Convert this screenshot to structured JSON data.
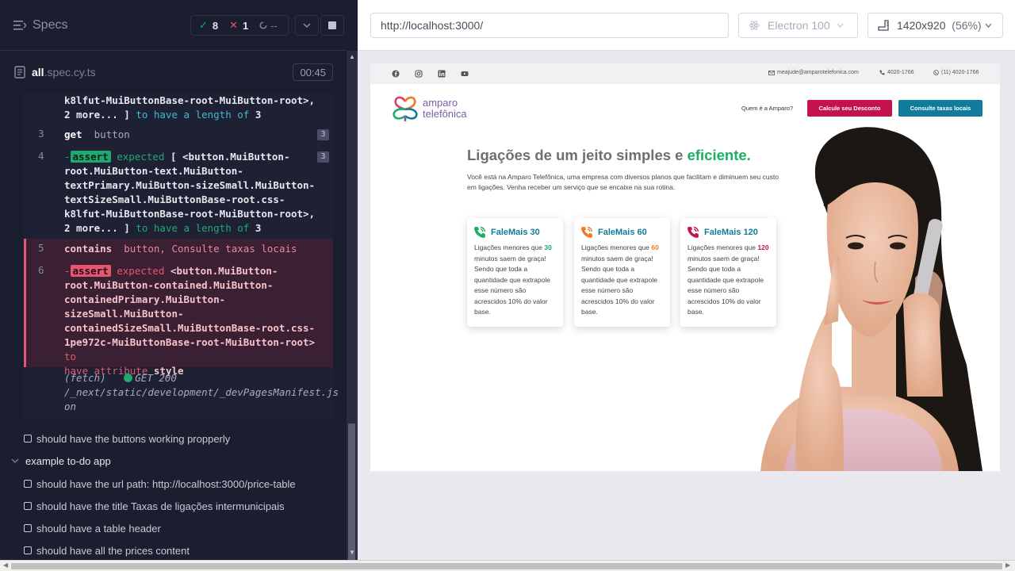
{
  "runner": {
    "title": "Specs",
    "stats": {
      "passed": "8",
      "failed": "1",
      "pending": "--"
    },
    "file": {
      "name_bold": "all",
      "name_ext": ".spec.cy.ts",
      "time": "00:45"
    }
  },
  "commands": {
    "top_line1": "k8lfut-MuiButtonBase-root-MuiButton-root>,",
    "top_line2a": "2 more... ]",
    "top_line2b": "to have a length of",
    "top_line2c": "3",
    "c3": {
      "num": "3",
      "name": "get",
      "arg": "button",
      "count": "3"
    },
    "c4": {
      "num": "4",
      "badge": "assert",
      "text1": "expected",
      "lines": [
        "[ <button.MuiButton-",
        "root.MuiButton-text.MuiButton-",
        "textPrimary.MuiButton-sizeSmall.MuiButton-",
        "textSizeSmall.MuiButtonBase-root.css-",
        "k8lfut-MuiButtonBase-root-MuiButton-root>,"
      ],
      "last_a": "2 more... ]",
      "last_b": "to have a length of",
      "last_c": "3",
      "count": "3"
    },
    "c5": {
      "num": "5",
      "name": "contains",
      "arg": "button, Consulte taxas locais"
    },
    "c6": {
      "num": "6",
      "badge": "assert",
      "text1": "expected",
      "lines": [
        "<button.MuiButton-",
        "root.MuiButton-contained.MuiButton-",
        "containedPrimary.MuiButton-",
        "sizeSmall.MuiButton-",
        "containedSizeSmall.MuiButtonBase-root.css-"
      ],
      "last_a": "1pe972c-MuiButtonBase-root-MuiButton-root>",
      "last_b": "to",
      "last_c": "have attribute",
      "last_d": "style"
    },
    "fetch": {
      "label": "(fetch)",
      "status": "GET 200",
      "path": "/_next/static/development/_devPagesManifest.js",
      "path2": "on"
    }
  },
  "tests": {
    "t1": "should have the buttons working propperly",
    "suite": "example to-do app",
    "t2": "should have the url path: http://localhost:3000/price-table",
    "t3": "should have the title Taxas de ligações intermunicipais",
    "t4": "should have a table header",
    "t5": "should have all the prices content"
  },
  "aut": {
    "url": "http://localhost:3000/",
    "browser": "Electron 100",
    "viewport": "1420x920",
    "zoom": "(56%)"
  },
  "site": {
    "email": "meajude@amparotelefonica.com",
    "phone": "4020-1766",
    "whatsapp": "(11) 4020-1766",
    "logo_line1": "amparo",
    "logo_line2": "telefônica",
    "nav_about": "Quem é a Amparo?",
    "btn_discount": "Calcule seu Desconto",
    "btn_rates": "Consulte taxas locais",
    "hero_title_a": "Ligações de um jeito simples e",
    "hero_title_b": "eficiente.",
    "hero_sub": "Você está na Amparo Telefônica, uma empresa com diversos planos que facilitam e diminuem seu custo em ligações. Venha receber um serviço que se encaixe na sua rotina.",
    "cards": [
      {
        "title": "FaleMais 30",
        "pre": "Ligações menores que",
        "num": "30",
        "post": "minutos saem de graça! Sendo que toda a quantidade que extrapole esse número são acrescidos 10% do valor base.",
        "color": "#1aaf63"
      },
      {
        "title": "FaleMais 60",
        "pre": "Ligações menores que",
        "num": "60",
        "post": "minutos saem de graça! Sendo que toda a quantidade que extrapole esse número são acrescidos 10% do valor base.",
        "color": "#f07a22"
      },
      {
        "title": "FaleMais 120",
        "pre": "Ligações menores que",
        "num": "120",
        "post": "minutos saem de graça! Sendo que toda a quantidade que extrapole esse número são acrescidos 10% do valor base.",
        "color": "#c4124c"
      }
    ]
  }
}
